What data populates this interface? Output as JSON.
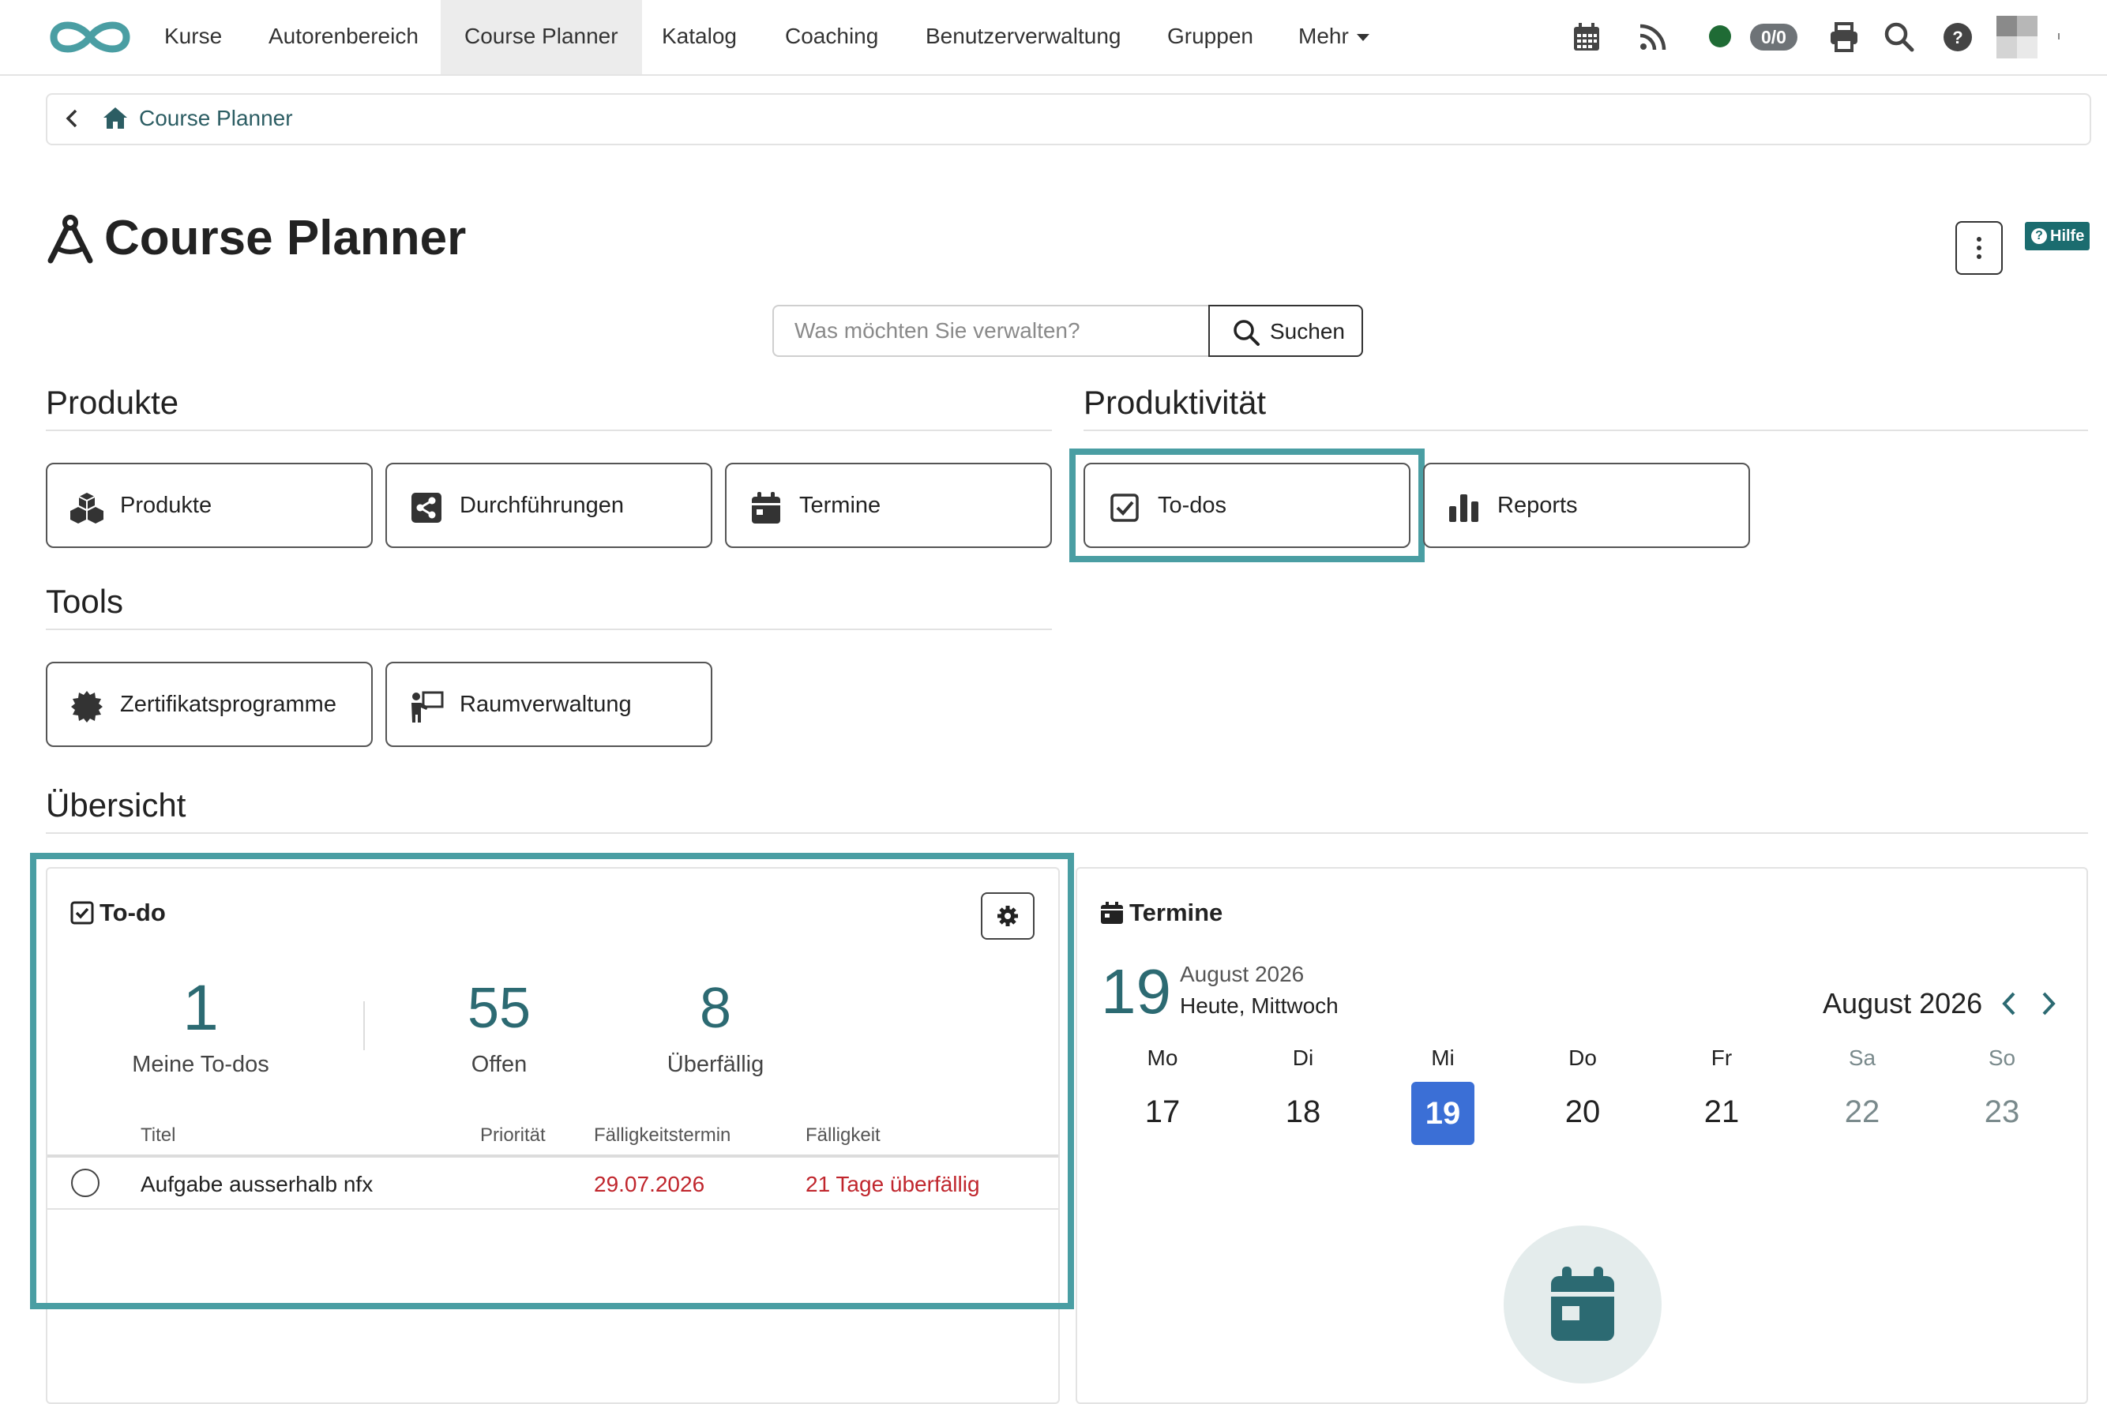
{
  "nav": {
    "items": [
      {
        "label": "Kurse"
      },
      {
        "label": "Autorenbereich"
      },
      {
        "label": "Course Planner",
        "active": true
      },
      {
        "label": "Katalog"
      },
      {
        "label": "Coaching"
      },
      {
        "label": "Benutzerverwaltung"
      },
      {
        "label": "Gruppen"
      },
      {
        "label": "Mehr"
      }
    ],
    "status_count": "0/0",
    "icons": [
      "calendar-icon",
      "rss-icon",
      "status-dot",
      "print-icon",
      "search-icon",
      "help-icon",
      "avatar"
    ]
  },
  "breadcrumb": {
    "current": "Course Planner"
  },
  "page": {
    "title": "Course Planner",
    "help_label": "Hilfe"
  },
  "search": {
    "placeholder": "Was möchten Sie verwalten?",
    "button_label": "Suchen"
  },
  "sections": {
    "produkte": {
      "title": "Produkte",
      "tiles": [
        {
          "label": "Produkte",
          "icon": "cubes-icon"
        },
        {
          "label": "Durchführungen",
          "icon": "share-icon"
        },
        {
          "label": "Termine",
          "icon": "calendar-icon"
        }
      ]
    },
    "produktivitaet": {
      "title": "Produktivität",
      "tiles": [
        {
          "label": "To-dos",
          "icon": "checkbox-icon",
          "highlighted": true
        },
        {
          "label": "Reports",
          "icon": "bar-chart-icon"
        }
      ]
    },
    "tools": {
      "title": "Tools",
      "tiles": [
        {
          "label": "Zertifikatsprogramme",
          "icon": "certificate-icon"
        },
        {
          "label": "Raumverwaltung",
          "icon": "presenter-icon"
        }
      ]
    },
    "uebersicht": {
      "title": "Übersicht"
    }
  },
  "todo": {
    "title": "To-do",
    "stats": [
      {
        "value": "1",
        "label": "Meine To-dos"
      },
      {
        "value": "55",
        "label": "Offen"
      },
      {
        "value": "8",
        "label": "Überfällig"
      }
    ],
    "columns": [
      "Titel",
      "Priorität",
      "Fälligkeitstermin",
      "Fälligkeit"
    ],
    "rows": [
      {
        "title": "Aufgabe ausserhalb nfx",
        "priority": "",
        "due_date": "29.07.2026",
        "due_status": "21 Tage überfällig"
      }
    ]
  },
  "termine": {
    "title": "Termine",
    "today_day": "19",
    "today_month": "August 2026",
    "today_label": "Heute, Mittwoch",
    "calendar_month": "August 2026",
    "weekdays": [
      "Mo",
      "Di",
      "Mi",
      "Do",
      "Fr",
      "Sa",
      "So"
    ],
    "days": [
      "17",
      "18",
      "19",
      "20",
      "21",
      "22",
      "23"
    ],
    "today_index": 2
  },
  "colors": {
    "accent": "#2c6a72",
    "highlight": "#4a9ea3",
    "today": "#3b6fd6",
    "overdue": "#c0262d",
    "status": "#1f6b35"
  }
}
